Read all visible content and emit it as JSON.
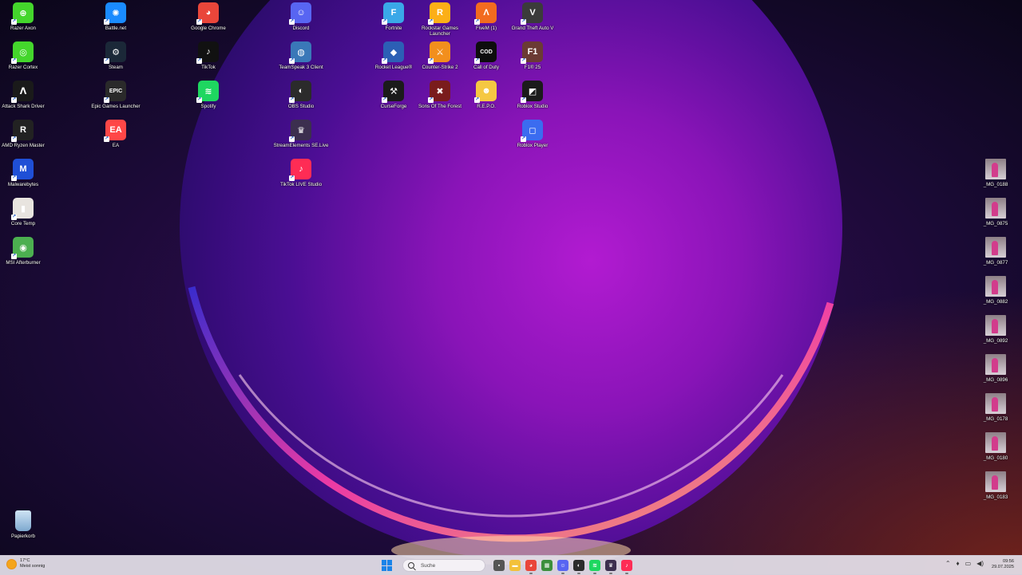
{
  "desktop": {
    "icons_left": [
      {
        "label": "Razer Axon",
        "glyph": "⊕",
        "bg": "#44d62c",
        "icon": "razer-axon-icon"
      },
      {
        "label": "Razer Cortex",
        "glyph": "◎",
        "bg": "#44d62c",
        "icon": "razer-cortex-icon"
      },
      {
        "label": "Attack Shark Driver",
        "glyph": "ᐱ",
        "bg": "#1a1a1a",
        "icon": "attack-shark-icon"
      },
      {
        "label": "AMD Ryzen Master",
        "glyph": "R",
        "bg": "#222222",
        "icon": "ryzen-master-icon"
      },
      {
        "label": "Malwarebytes",
        "glyph": "M",
        "bg": "#1f4fd6",
        "icon": "malwarebytes-icon"
      },
      {
        "label": "Core Temp",
        "glyph": "▮",
        "bg": "#e8e4df",
        "icon": "core-temp-icon"
      },
      {
        "label": "MSI Afterburner",
        "glyph": "◉",
        "bg": "#4caf50",
        "icon": "msi-afterburner-icon"
      }
    ],
    "icons_col2": [
      {
        "label": "Battle.net",
        "glyph": "✺",
        "bg": "#1a8bff",
        "icon": "battlenet-icon"
      },
      {
        "label": "Steam",
        "glyph": "⚙",
        "bg": "#1b2838",
        "icon": "steam-icon"
      },
      {
        "label": "Epic Games Launcher",
        "glyph": "EPIC",
        "bg": "#2a2a2a",
        "icon": "epic-games-icon"
      },
      {
        "label": "EA",
        "glyph": "EA",
        "bg": "#ff4747",
        "icon": "ea-icon"
      }
    ],
    "icons_col3": [
      {
        "label": "Google Chrome",
        "glyph": "◕",
        "bg": "#e9463a",
        "icon": "chrome-icon"
      },
      {
        "label": "TikTok",
        "glyph": "♪",
        "bg": "#111111",
        "icon": "tiktok-icon"
      },
      {
        "label": "Spotify",
        "glyph": "≋",
        "bg": "#1ed760",
        "icon": "spotify-icon"
      }
    ],
    "icons_col4": [
      {
        "label": "Discord",
        "glyph": "☺",
        "bg": "#5865f2",
        "icon": "discord-icon"
      },
      {
        "label": "TeamSpeak 3 Client",
        "glyph": "◍",
        "bg": "#3a78b8",
        "icon": "teamspeak-icon"
      },
      {
        "label": "OBS Studio",
        "glyph": "◐",
        "bg": "#2b2b2b",
        "icon": "obs-icon"
      },
      {
        "label": "StreamElements SE.Live",
        "glyph": "♛",
        "bg": "#3c2f4f",
        "icon": "streamelements-icon"
      },
      {
        "label": "TikTok LIVE Studio",
        "glyph": "♪",
        "bg": "#fe2c55",
        "icon": "tiktok-live-icon"
      }
    ],
    "icons_col5": [
      {
        "label": "Fortnite",
        "glyph": "F",
        "bg": "#3aa8e8",
        "icon": "fortnite-icon"
      },
      {
        "label": "Rocket League®",
        "glyph": "◆",
        "bg": "#2c5fb5",
        "icon": "rocket-league-icon"
      },
      {
        "label": "CurseForge",
        "glyph": "⚒",
        "bg": "#1b1b1b",
        "icon": "curseforge-icon"
      }
    ],
    "icons_col6": [
      {
        "label": "Rockstar Games Launcher",
        "glyph": "R",
        "bg": "#fcaf17",
        "icon": "rockstar-icon"
      },
      {
        "label": "Counter-Strike 2",
        "glyph": "⚔",
        "bg": "#f28f1d",
        "icon": "cs2-icon"
      },
      {
        "label": "Sons Of The Forest",
        "glyph": "✖",
        "bg": "#7a1c1c",
        "icon": "sons-forest-icon"
      }
    ],
    "icons_col7": [
      {
        "label": "FiveM (1)",
        "glyph": "Λ",
        "bg": "#f26b1f",
        "icon": "fivem-icon"
      },
      {
        "label": "Call of Duty",
        "glyph": "COD",
        "bg": "#0d0d0d",
        "icon": "call-of-duty-icon"
      },
      {
        "label": "R.E.P.O.",
        "glyph": "☻",
        "bg": "#f5c842",
        "icon": "repo-icon"
      }
    ],
    "icons_col8": [
      {
        "label": "Grand Theft Auto V",
        "glyph": "V",
        "bg": "#3b3b3b",
        "icon": "gta-v-icon"
      },
      {
        "label": "F1® 25",
        "glyph": "F1",
        "bg": "#6b3b34",
        "icon": "f1-25-icon"
      },
      {
        "label": "Roblox Studio",
        "glyph": "◩",
        "bg": "#1b1b1b",
        "icon": "roblox-studio-icon"
      },
      {
        "label": "Roblox Player",
        "glyph": "◻",
        "bg": "#3b6cf0",
        "icon": "roblox-player-icon"
      }
    ],
    "photos": [
      {
        "label": "_MG_0188"
      },
      {
        "label": "_MG_0875"
      },
      {
        "label": "_MG_0877"
      },
      {
        "label": "_MG_0882"
      },
      {
        "label": "_MG_0892"
      },
      {
        "label": "_MG_0896"
      },
      {
        "label": "_MG_0178"
      },
      {
        "label": "_MG_0180"
      },
      {
        "label": "_MG_0183"
      }
    ],
    "recycle_bin": {
      "label": "Papierkorb"
    }
  },
  "taskbar": {
    "weather": {
      "temp": "17°C",
      "condition": "Meist sonnig"
    },
    "search_placeholder": "Suche",
    "apps": [
      {
        "icon": "task-view-icon",
        "glyph": "▪",
        "bg": "#555555"
      },
      {
        "icon": "file-explorer-icon",
        "glyph": "▬",
        "bg": "#f3c13a"
      },
      {
        "icon": "chrome-icon",
        "glyph": "◕",
        "bg": "#e9463a"
      },
      {
        "icon": "minecraft-icon",
        "glyph": "▦",
        "bg": "#3c8f3c"
      },
      {
        "icon": "discord-icon",
        "glyph": "☺",
        "bg": "#5865f2"
      },
      {
        "icon": "obs-icon",
        "glyph": "◐",
        "bg": "#2b2b2b"
      },
      {
        "icon": "spotify-icon",
        "glyph": "≋",
        "bg": "#1ed760"
      },
      {
        "icon": "streamelements-icon",
        "glyph": "♛",
        "bg": "#3c2f4f"
      },
      {
        "icon": "tiktok-live-icon",
        "glyph": "♪",
        "bg": "#fe2c55"
      }
    ],
    "tray": [
      "⌃",
      "♦",
      "▭",
      "◀)"
    ],
    "time": "09:56",
    "date": "29.07.2025"
  }
}
